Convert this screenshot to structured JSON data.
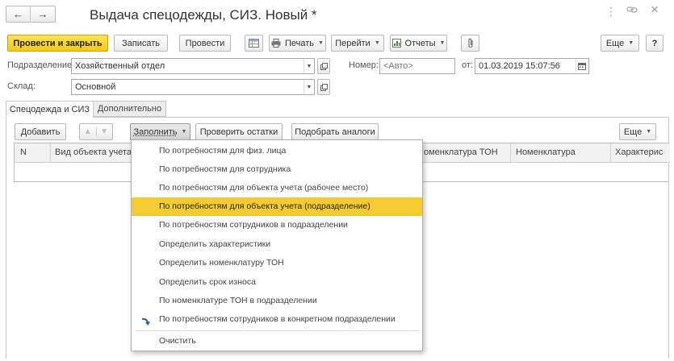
{
  "window": {
    "title": "Выдача спецодежды, СИЗ. Новый *",
    "nav_back": "←",
    "nav_forward": "→",
    "star": "☆",
    "menu_dots": "⋮",
    "link": "🔗",
    "close": "×"
  },
  "toolbar": {
    "post_close": "Провести и закрыть",
    "save": "Записать",
    "post": "Провести",
    "print": "Печать",
    "goto": "Перейти",
    "reports": "Отчеты",
    "more": "Еще",
    "help": "?"
  },
  "form": {
    "division_label": "Подразделение:",
    "division_value": "Хозяйственный отдел",
    "number_label": "Номер:",
    "number_placeholder": "<Авто>",
    "date_label": "от:",
    "date_value": "01.03.2019 15:07:56",
    "warehouse_label": "Склад:",
    "warehouse_value": "Основной"
  },
  "tabs": [
    "Спецодежда и СИЗ",
    "Дополнительно"
  ],
  "table_toolbar": {
    "add": "Добавить",
    "fill": "Заполнить",
    "check_stock": "Проверить остатки",
    "find_analogs": "Подобрать аналоги",
    "more": "Еще"
  },
  "table": {
    "columns": [
      "N",
      "Вид объекта учета",
      "оменклатура ТОН",
      "Номенклатура",
      "Характерис"
    ]
  },
  "dropdown": {
    "items": [
      "По потребностям для физ. лица",
      "По потребностям для сотрудника",
      "По потребностям для объекта учета (рабочее место)",
      "По потребностям для объекта учета (подразделение)",
      "По потребностям сотрудников в подразделении",
      "Определить характеристики",
      "Определить номенклатуру ТОН",
      "Определить срок износа",
      "По номенклатуре ТОН в подразделении",
      "По потребностям сотрудников в конкретном подразделении",
      "Очистить"
    ],
    "selected_index": 3,
    "highlight_color": "#f4cc2f"
  },
  "colors": {
    "primary_button": "#f4d43a",
    "primary_border": "#c9a400"
  }
}
